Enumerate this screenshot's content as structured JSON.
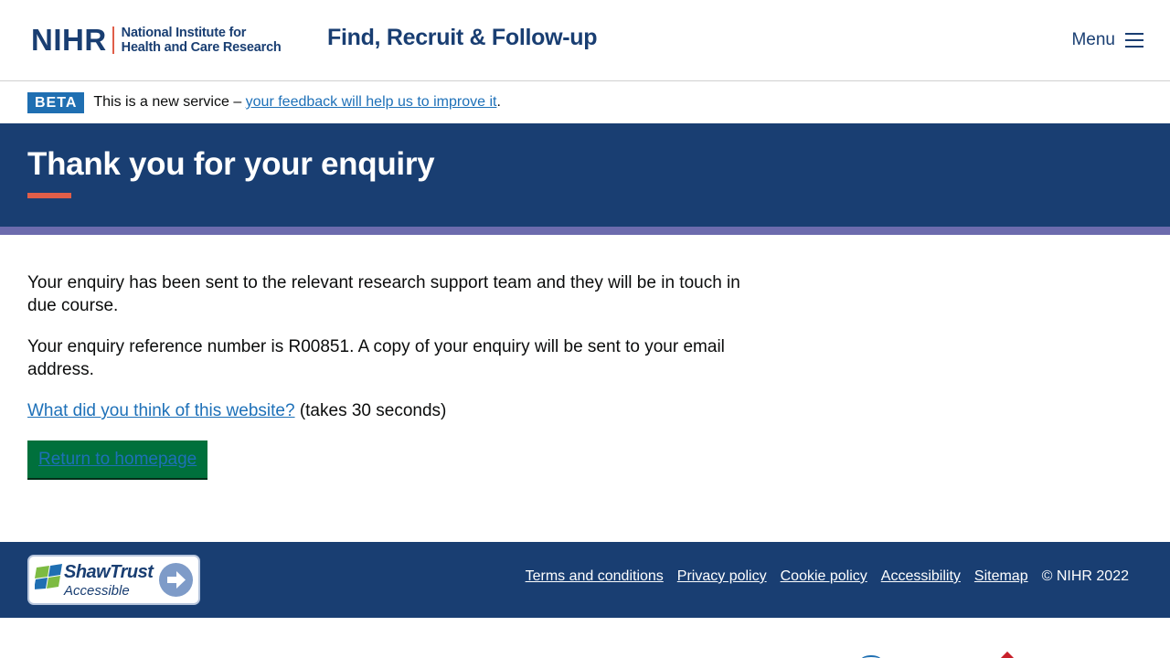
{
  "header": {
    "logo_mark": "NIHR",
    "logo_line1": "National Institute for",
    "logo_line2": "Health and Care Research",
    "service_name": "Find, Recruit & Follow-up",
    "menu_label": "Menu"
  },
  "beta": {
    "tag": "BETA",
    "text": "This is a new service – ",
    "link": "your feedback will help us to improve it",
    "suffix": "."
  },
  "hero": {
    "title": "Thank you for your enquiry"
  },
  "main": {
    "para1": "Your enquiry has been sent to the relevant research support team and they will be in touch in due course.",
    "para2": "Your enquiry reference number is R00851. A copy of your enquiry will be sent to your email address.",
    "survey_link": "What did you think of this website?",
    "survey_suffix": " (takes 30 seconds)",
    "return_button": "Return to homepage"
  },
  "footer": {
    "badge_title": "ShawTrust",
    "badge_sub": "Accessible",
    "links": [
      "Terms and conditions",
      "Privacy policy",
      "Cookie policy",
      "Accessibility",
      "Sitemap"
    ],
    "copyright": "© NIHR 2022"
  },
  "colors": {
    "brand_navy": "#193e72",
    "accent_coral": "#e05e49",
    "stripe_purple": "#6c6bad",
    "button_green": "#00703c",
    "link_blue": "#1d70b8"
  }
}
